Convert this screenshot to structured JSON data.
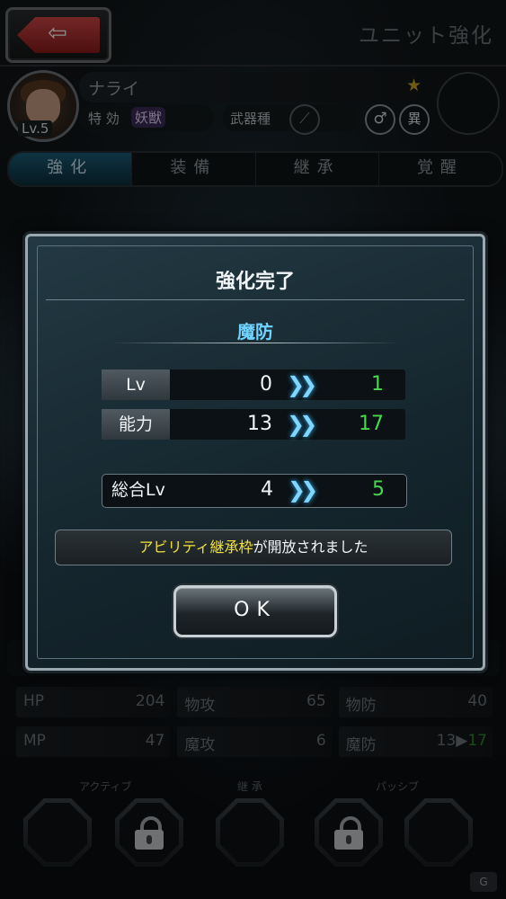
{
  "header": {
    "title": "ユニット強化",
    "back_icon": "back-arrow-icon"
  },
  "unit": {
    "name": "ナライ",
    "level": "Lv.5",
    "special_label": "特 効",
    "special_value": "妖獣",
    "weapon_label": "武器種",
    "gender_symbol": "♂",
    "alt_badge": "異"
  },
  "tabs": [
    {
      "label": "強化",
      "active": true
    },
    {
      "label": "装備",
      "active": false
    },
    {
      "label": "継承",
      "active": false
    },
    {
      "label": "覚醒",
      "active": false
    }
  ],
  "stats": {
    "rows": [
      [
        {
          "label": "HP",
          "value": "204"
        },
        {
          "label": "物攻",
          "value": "65"
        },
        {
          "label": "物防",
          "value": "40"
        }
      ],
      [
        {
          "label": "MP",
          "value": "47"
        },
        {
          "label": "魔攻",
          "value": "6"
        },
        {
          "label": "魔防",
          "value": "13",
          "arrow": "▶",
          "new_value": "17"
        }
      ]
    ]
  },
  "abilities": {
    "active_label": "アクティブ",
    "inherit_label": "継 承",
    "passive_label": "パッシブ"
  },
  "dialog": {
    "title": "強化完了",
    "stat_name": "魔防",
    "rows": [
      {
        "label": "Lv",
        "old": "0",
        "new": "1"
      },
      {
        "label": "能力",
        "old": "13",
        "new": "17"
      }
    ],
    "total": {
      "label": "総合Lv",
      "old": "4",
      "new": "5"
    },
    "arrow": "❯❯",
    "notice_highlight": "アビリティ継承枠",
    "notice_rest": "が開放されました",
    "ok_label": "OK"
  },
  "colors": {
    "accent_blue": "#6fd3ff",
    "increase_green": "#49d84d",
    "notice_yellow": "#f2e23a"
  }
}
